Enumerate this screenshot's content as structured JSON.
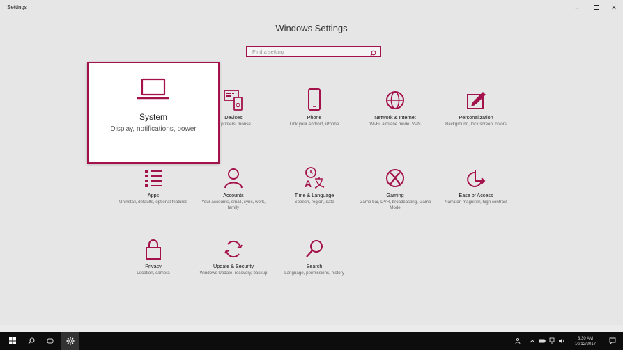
{
  "window": {
    "title": "Settings",
    "controls": {
      "minimize": "–",
      "close": "✕"
    }
  },
  "page": {
    "title": "Windows Settings"
  },
  "search": {
    "placeholder": "Find a setting",
    "icon": "search-icon"
  },
  "accent_color": "#a3124a",
  "tiles": {
    "system": {
      "name": "System",
      "desc": "Display, notifications, power",
      "icon": "laptop-icon"
    },
    "devices": {
      "name": "Devices",
      "desc": "h, printers, mouse",
      "icon": "devices-icon"
    },
    "phone": {
      "name": "Phone",
      "desc": "Link your Android, iPhone",
      "icon": "phone-icon"
    },
    "network": {
      "name": "Network & Internet",
      "desc": "Wi-Fi, airplane mode, VPN",
      "icon": "globe-icon"
    },
    "personalization": {
      "name": "Personalization",
      "desc": "Background, lock screen, colors",
      "icon": "paint-icon"
    },
    "apps": {
      "name": "Apps",
      "desc": "Uninstall, defaults, optional features",
      "icon": "apps-list-icon"
    },
    "accounts": {
      "name": "Accounts",
      "desc": "Your accounts, email, sync, work, family",
      "icon": "person-icon"
    },
    "time": {
      "name": "Time & Language",
      "desc": "Speech, region, date",
      "icon": "time-language-icon"
    },
    "gaming": {
      "name": "Gaming",
      "desc": "Game bar, DVR, broadcasting, Game Mode",
      "icon": "xbox-icon"
    },
    "ease": {
      "name": "Ease of Access",
      "desc": "Narrator, magnifier, high contrast",
      "icon": "ease-of-access-icon"
    },
    "privacy": {
      "name": "Privacy",
      "desc": "Location, camera",
      "icon": "lock-icon"
    },
    "update": {
      "name": "Update & Security",
      "desc": "Windows Update, recovery, backup",
      "icon": "sync-icon"
    },
    "searchtile": {
      "name": "Search",
      "desc": "Language, permissions, history",
      "icon": "search-icon"
    }
  },
  "taskbar": {
    "items": [
      "windows-start-icon",
      "search-icon",
      "task-view-icon",
      "settings-gear-icon"
    ],
    "tray": {
      "time": "3:30 AM",
      "date": "10/12/2017"
    }
  }
}
